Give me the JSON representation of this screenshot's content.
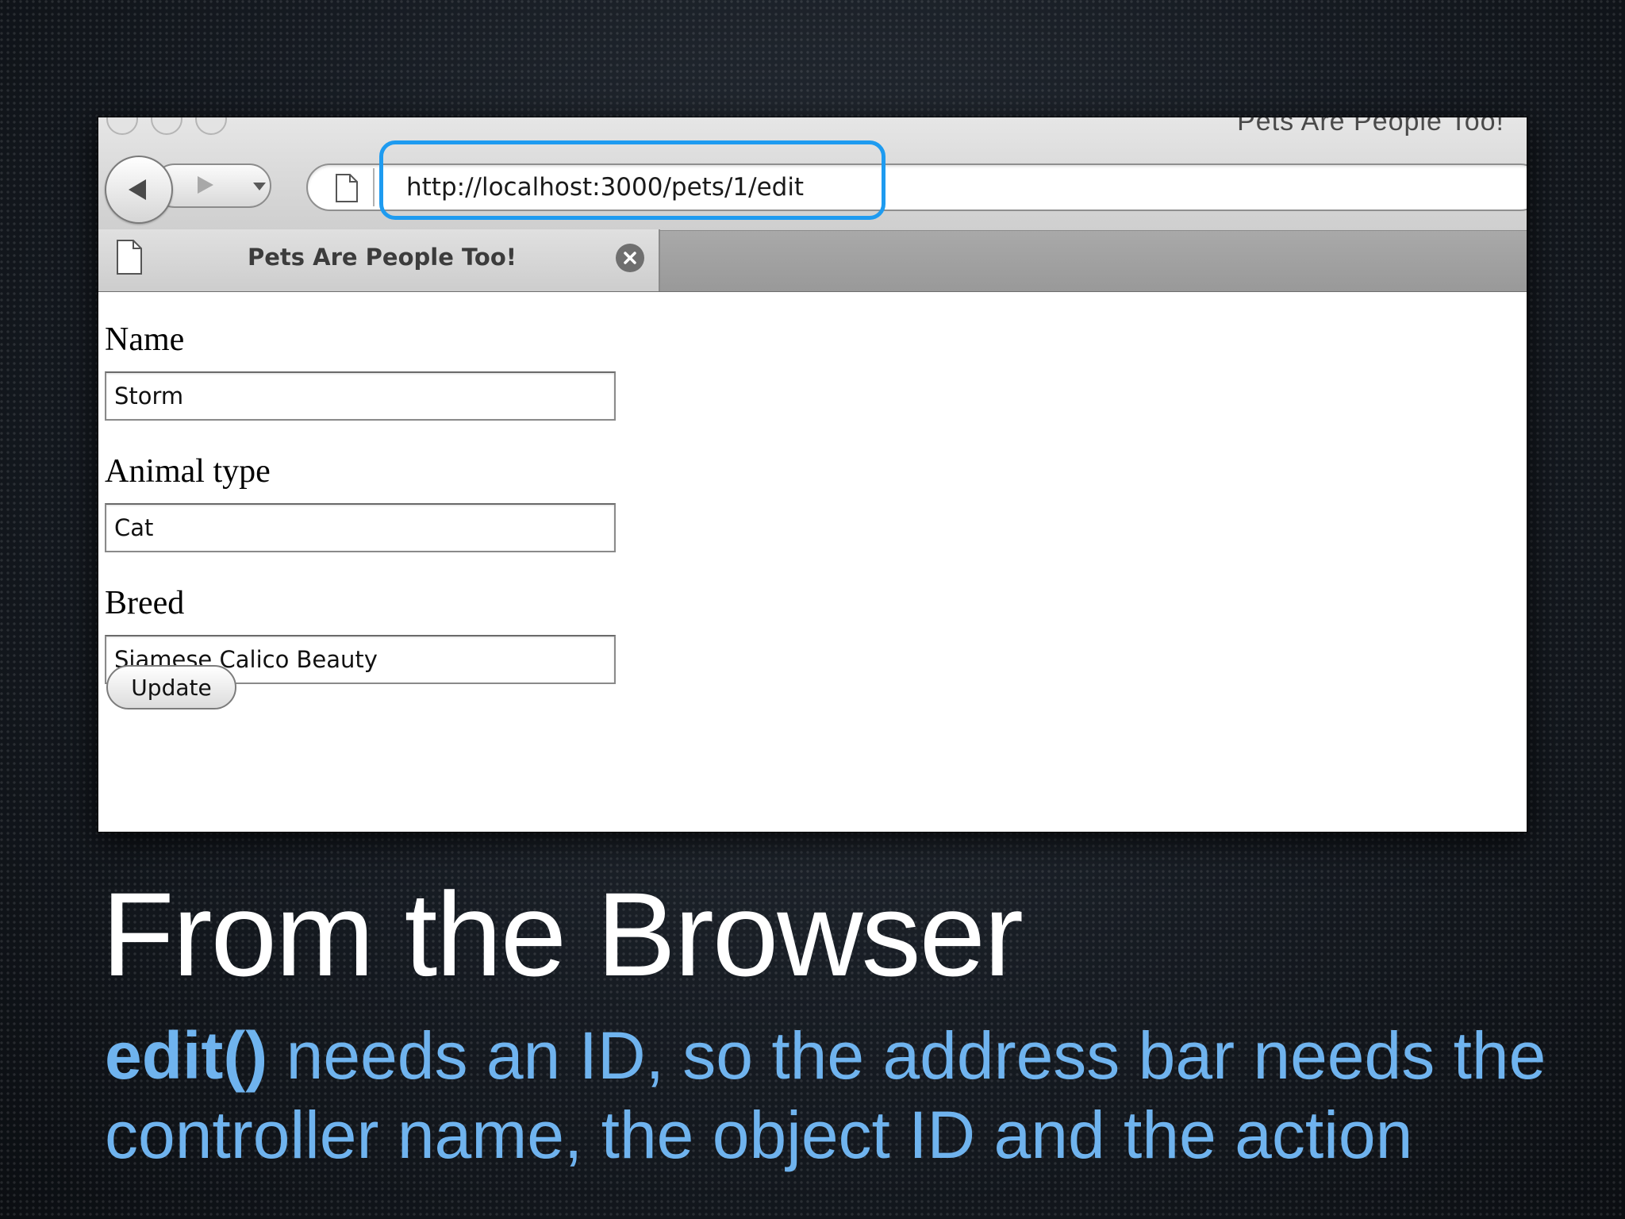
{
  "browser": {
    "window_title": "Pets Are People Too!",
    "address_bar": {
      "url": "http://localhost:3000/pets/1/edit"
    },
    "tab": {
      "title": "Pets Are People Too!"
    }
  },
  "form": {
    "fields": [
      {
        "label": "Name",
        "value": "Storm"
      },
      {
        "label": "Animal type",
        "value": "Cat"
      },
      {
        "label": "Breed",
        "value": "Siamese Calico Beauty"
      }
    ],
    "submit_label": "Update"
  },
  "slide": {
    "title": "From the Browser",
    "body_emphasis": "edit()",
    "body_text_line1": " needs an ID, so the address bar needs the",
    "body_text_line2": "controller name, the object ID and the action"
  },
  "colors": {
    "highlight": "#1e9bf0",
    "body_text": "#6fb3ee"
  }
}
